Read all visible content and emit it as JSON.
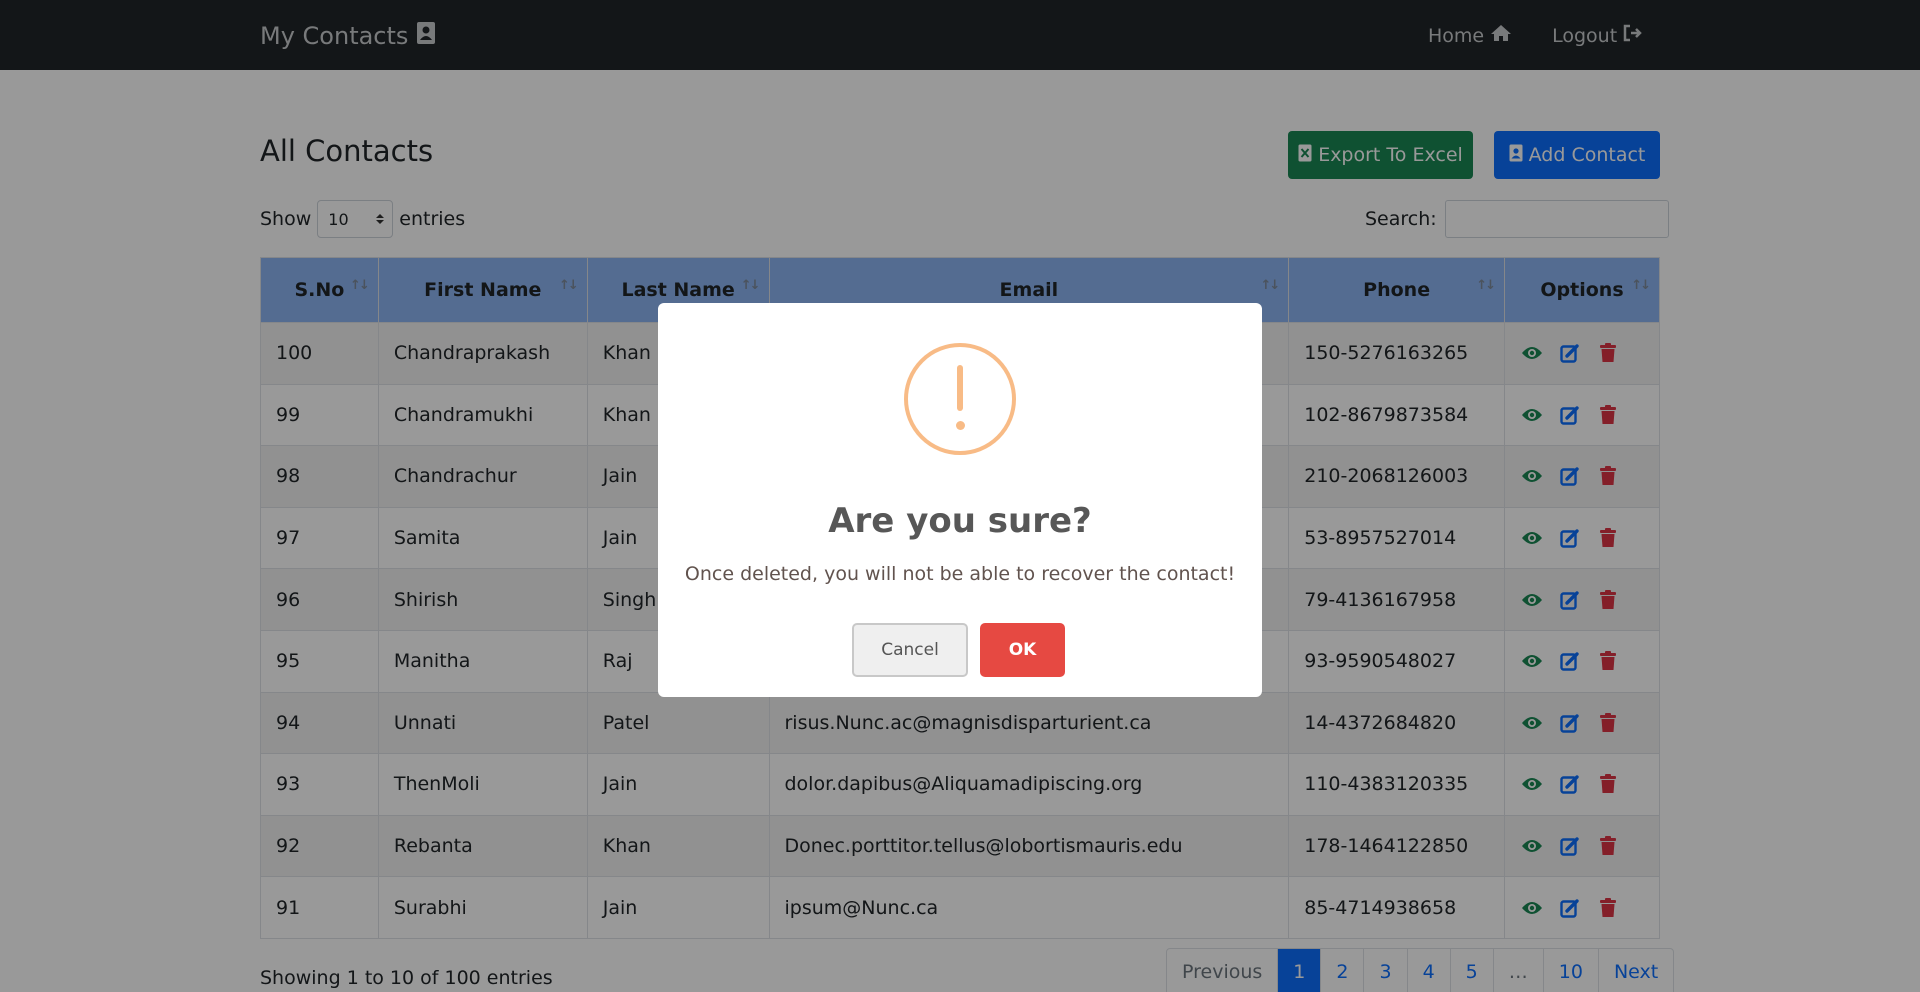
{
  "navbar": {
    "brand": "My Contacts",
    "home": "Home",
    "logout": "Logout"
  },
  "page": {
    "title": "All Contacts",
    "export_label": "Export To Excel",
    "add_label": "Add Contact",
    "show_label": "Show",
    "entries_label": "entries",
    "length_value": "10",
    "search_label": "Search:",
    "search_value": ""
  },
  "table": {
    "headers": [
      "S.No",
      "First Name",
      "Last Name",
      "Email",
      "Phone",
      "Options"
    ],
    "rows": [
      {
        "sno": "100",
        "first": "Chandraprakash",
        "last": "Khan",
        "email": "",
        "phone": "150-5276163265"
      },
      {
        "sno": "99",
        "first": "Chandramukhi",
        "last": "Khan",
        "email": "",
        "phone": "102-8679873584"
      },
      {
        "sno": "98",
        "first": "Chandrachur",
        "last": "Jain",
        "email": "",
        "phone": "210-2068126003"
      },
      {
        "sno": "97",
        "first": "Samita",
        "last": "Jain",
        "email": "",
        "phone": "53-8957527014"
      },
      {
        "sno": "96",
        "first": "Shirish",
        "last": "Singh",
        "email": "",
        "phone": "79-4136167958"
      },
      {
        "sno": "95",
        "first": "Manitha",
        "last": "Raj",
        "email": "",
        "phone": "93-9590548027"
      },
      {
        "sno": "94",
        "first": "Unnati",
        "last": "Patel",
        "email": "risus.Nunc.ac@magnisdisparturient.ca",
        "phone": "14-4372684820"
      },
      {
        "sno": "93",
        "first": "ThenMoli",
        "last": "Jain",
        "email": "dolor.dapibus@Aliquamadipiscing.org",
        "phone": "110-4383120335"
      },
      {
        "sno": "92",
        "first": "Rebanta",
        "last": "Khan",
        "email": "Donec.porttitor.tellus@lobortismauris.edu",
        "phone": "178-1464122850"
      },
      {
        "sno": "91",
        "first": "Surabhi",
        "last": "Jain",
        "email": "ipsum@Nunc.ca",
        "phone": "85-4714938658"
      }
    ]
  },
  "footer": {
    "info": "Showing 1 to 10 of 100 entries",
    "pagination": [
      "Previous",
      "1",
      "2",
      "3",
      "4",
      "5",
      "…",
      "10",
      "Next"
    ]
  },
  "modal": {
    "title": "Are you sure?",
    "text": "Once deleted, you will not be able to recover the contact!",
    "cancel": "Cancel",
    "ok": "OK"
  },
  "colors": {
    "primary": "#0d6efd",
    "success": "#198754",
    "danger": "#dc3545",
    "warning_icon": "#f8bb86"
  },
  "icons": {
    "view": "eye-icon",
    "edit": "edit-icon",
    "delete": "trash-icon"
  }
}
